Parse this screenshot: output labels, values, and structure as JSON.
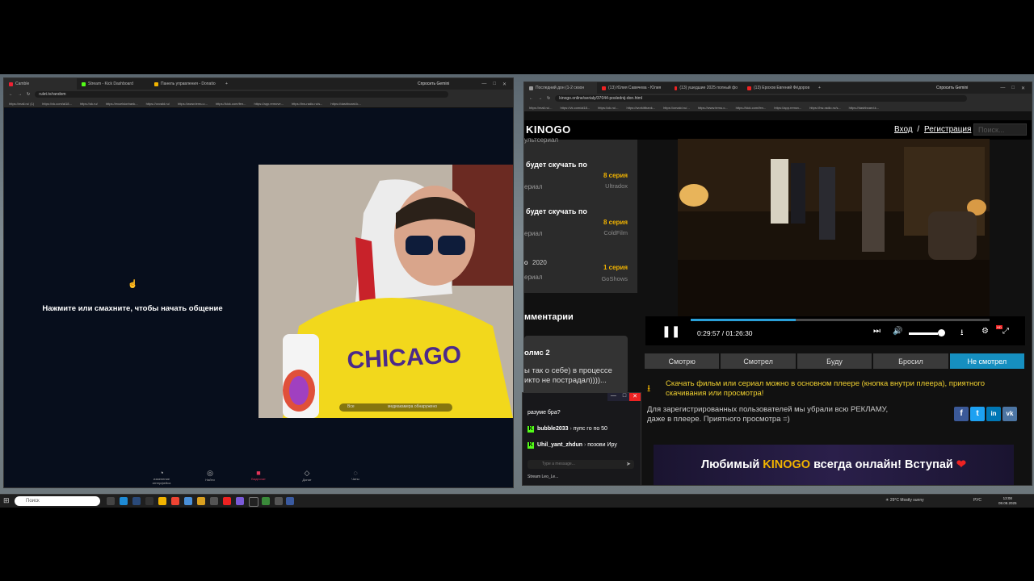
{
  "left_browser": {
    "tabs": [
      {
        "label": "Сamble",
        "active": true
      },
      {
        "label": "Stream - Kick Dashboard"
      },
      {
        "label": "Панель управления - Donatio"
      }
    ],
    "ask_gemini": "Спросить Gemini",
    "url": "rulet.tv/random",
    "bookmarks": [
      "https://mail.ru/ (1)",
      "https://vk.com/al18...",
      "https://ok.ru/",
      "https://excelsiorbank...",
      "https://oxvald.ru/",
      "https://www.temu.c...",
      "https://kick.com/fen...",
      "https://app.remove...",
      "https://hw-radio.ru/s...",
      "https://dashboard.k..."
    ],
    "hint": "Нажмите или смахните, чтобы начать общение",
    "cam_overlay": {
      "all": "Все",
      "camera": "медиакамера обнаружено"
    },
    "nav": [
      {
        "label": "изменение интерфейса",
        "icon": "user-icon"
      },
      {
        "label": "Найти",
        "icon": "search-icon"
      },
      {
        "label": "Видеочат",
        "icon": "video-icon",
        "active": true
      },
      {
        "label": "Донат",
        "icon": "gift-icon"
      },
      {
        "label": "Чаты",
        "icon": "chat-icon"
      }
    ]
  },
  "right_browser": {
    "tabs": [
      {
        "label": "Последний дон (1-2 сезон",
        "active": true
      },
      {
        "label": "(13) Юлия Савичева - Юлия"
      },
      {
        "label": "(13) ушедшие 2025 полный фо"
      },
      {
        "label": "(13) Ерохов Евгений Фёдоров"
      }
    ],
    "ask_gemini": "Спросить Gemini",
    "url": "kinogo.online/serialy/37044-poslednij-don.html",
    "bookmarks": [
      "https://mail.ru/...",
      "https://vk.com/al18...",
      "https://ok.ru/...",
      "https://workittbank...",
      "https://oxvald.ru/...",
      "https://www.temu.c...",
      "https://kick.com/fen...",
      "https://app.remov...",
      "https://hw-radio.ru/s...",
      "https://dashboard.k..."
    ]
  },
  "kinogo": {
    "logo": "KINOGO",
    "login": "Вход",
    "separator": "/",
    "register": "Регистрация",
    "search_placeholder": "Поиск...",
    "list": [
      {
        "title": "ультсериал",
        "sub": "",
        "episode": "",
        "source": ""
      },
      {
        "title": "будет скучать по",
        "sub": "ериал",
        "episode": "8 серия",
        "source": "Ultradox"
      },
      {
        "title": "будет скучать по",
        "sub": "ериал",
        "episode": "8 серия",
        "source": "ColdFilm"
      },
      {
        "title": "о",
        "year": "2020",
        "sub": "ериал",
        "episode": "1 серия",
        "source": "GoShows"
      }
    ],
    "comments_title": "мментарии",
    "comment": {
      "author": "олмс 2",
      "text1": "ы так о себе) в процессе",
      "text2": "икто не пострадал))))..."
    },
    "player": {
      "time": "0:29:57 / 01:26:30",
      "progress": 0.35,
      "volume": 0.9,
      "hd_badge": "HD"
    },
    "status_buttons": [
      {
        "label": "Смотрю"
      },
      {
        "label": "Смотрел"
      },
      {
        "label": "Буду"
      },
      {
        "label": "Бросил"
      },
      {
        "label": "Не смотрел",
        "active": true
      }
    ],
    "download_note": "Скачать фильм или сериал можно в основном плеере (кнопка внутри плеера), приятного скачивания или просмотра!",
    "info_note": "Для зарегистрированных пользователей мы убрали всю РЕКЛАМУ, даже в плеере. Приятного просмотра =)",
    "social": [
      "f",
      "t",
      "in",
      "vk"
    ],
    "banner": {
      "prefix": "Любимый ",
      "brand": "KINOGO",
      "suffix": " всегда онлайн! Вступай",
      "heart": "❤"
    }
  },
  "chat": {
    "messages": [
      {
        "user": "",
        "text": "разуме бра?"
      },
      {
        "user": "bubble2033",
        "text": "пупс го по 50"
      },
      {
        "user": "Uhil_yant_zhdun",
        "text": "позови Иру"
      }
    ],
    "input_placeholder": "Type a message...",
    "footer": "Stream Leo_Le..."
  },
  "taskbar": {
    "search_placeholder": "Поиск",
    "weather": "29°C  Mostly sunny",
    "lang": "РУС",
    "time": "13:08",
    "date": "08.08.2025"
  }
}
